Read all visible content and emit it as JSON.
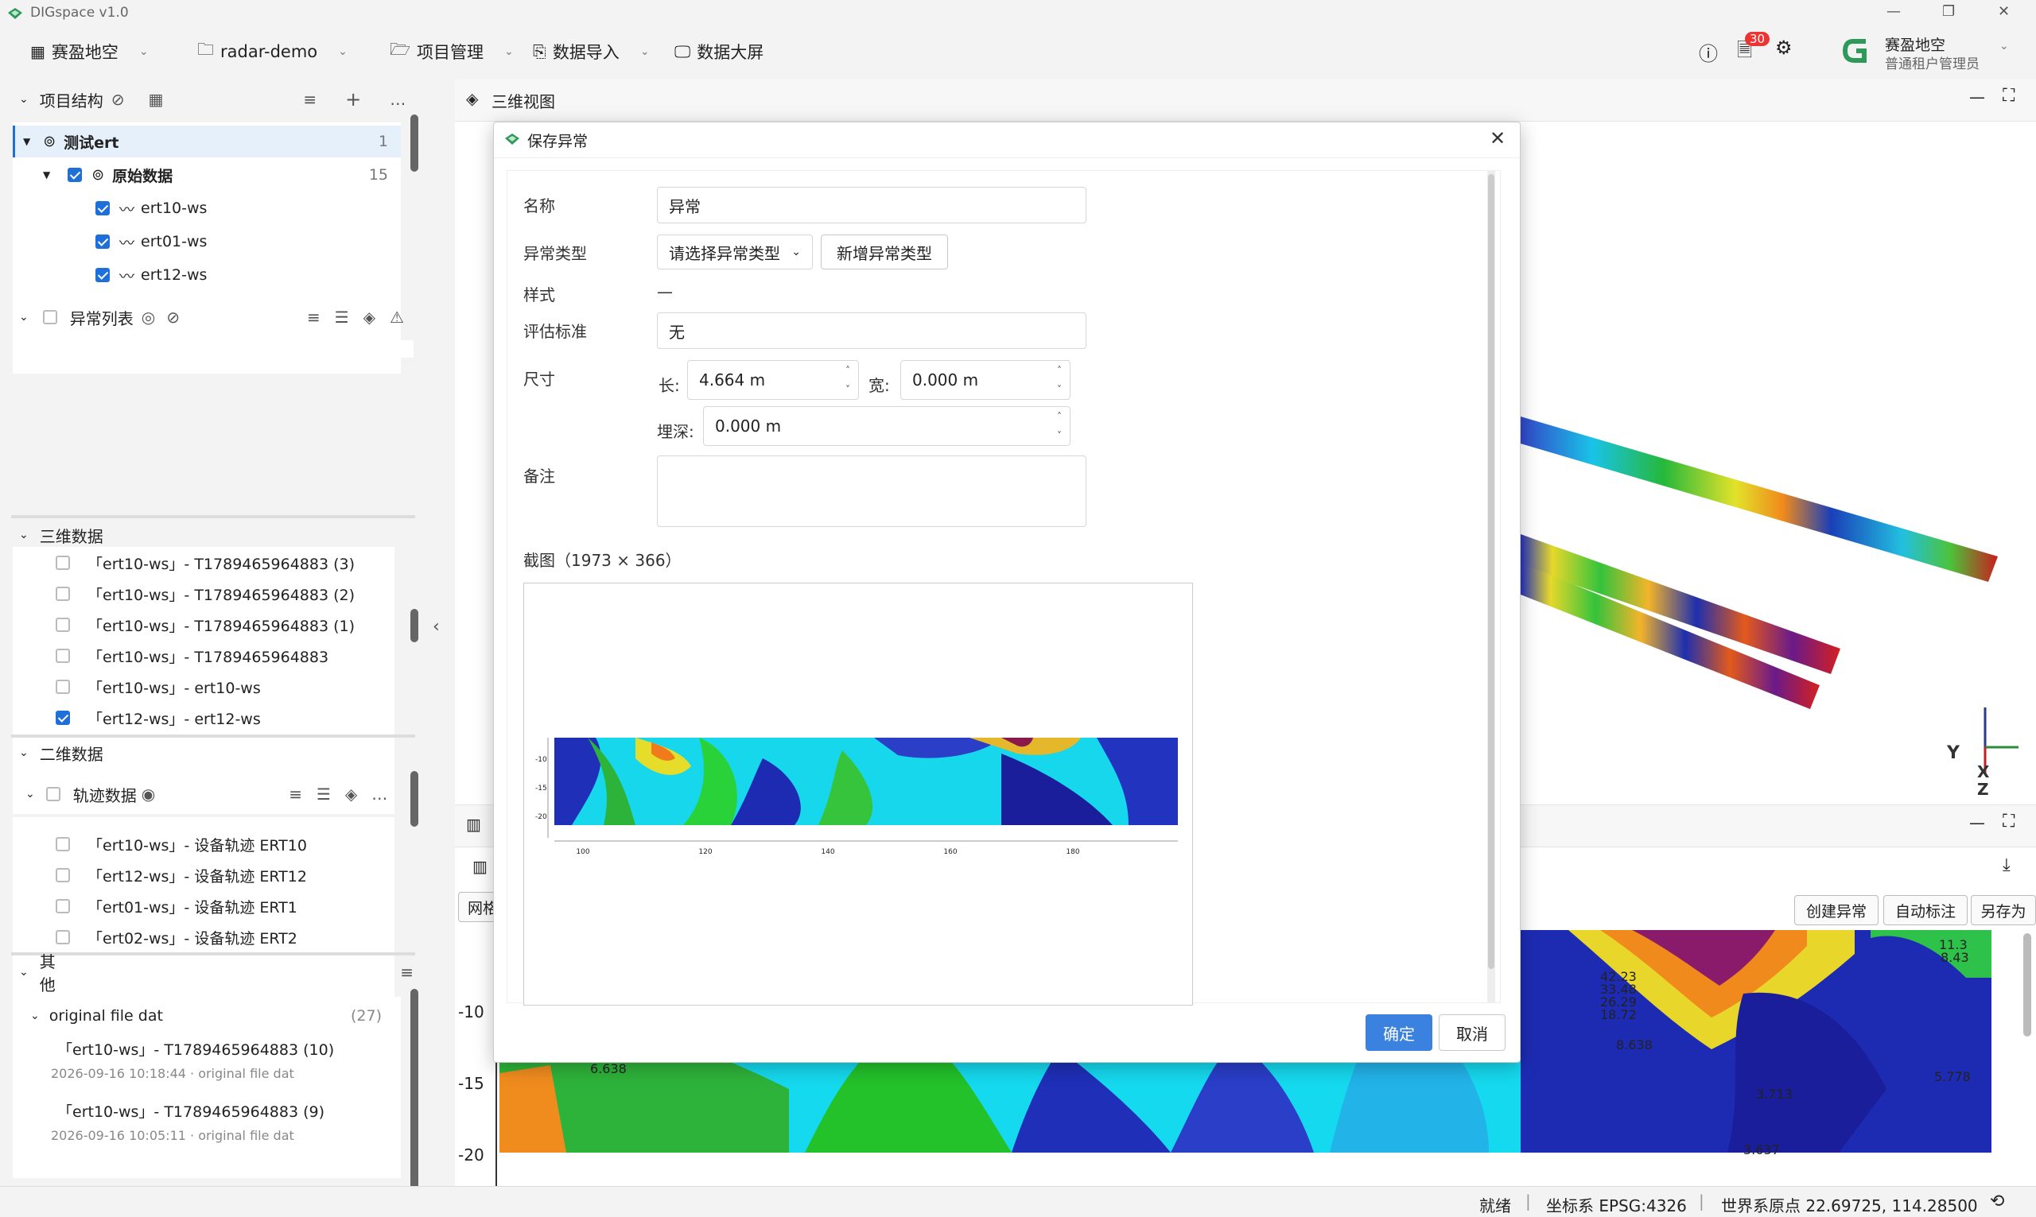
{
  "window": {
    "title": "DIGspace v1.0"
  },
  "menubar": {
    "org": "赛盈地空",
    "project": "radar-demo",
    "items": [
      "项目管理",
      "数据导入",
      "数据大屏"
    ],
    "notif_count": "30",
    "user_name": "赛盈地空",
    "user_role": "普通租户管理员"
  },
  "sidebar": {
    "project_structure": {
      "title": "项目结构",
      "root": {
        "label": "测试ert",
        "count": "1"
      },
      "group": {
        "label": "原始数据",
        "count": "15"
      },
      "items": [
        "ert10-ws",
        "ert01-ws",
        "ert12-ws"
      ]
    },
    "anomaly_list": {
      "title": "异常列表"
    },
    "three_d": {
      "title": "三维数据",
      "items": [
        {
          "label": "「ert10-ws」- T1789465964883 (3)",
          "checked": false
        },
        {
          "label": "「ert10-ws」- T1789465964883 (2)",
          "checked": false
        },
        {
          "label": "「ert10-ws」- T1789465964883 (1)",
          "checked": false
        },
        {
          "label": "「ert10-ws」- T1789465964883",
          "checked": false
        },
        {
          "label": "「ert10-ws」- ert10-ws",
          "checked": false
        },
        {
          "label": "「ert12-ws」- ert12-ws",
          "checked": true
        }
      ]
    },
    "two_d": {
      "title": "二维数据",
      "track_title": "轨迹数据",
      "items": [
        "「ert10-ws」- 设备轨迹 ERT10",
        "「ert12-ws」- 设备轨迹 ERT12",
        "「ert01-ws」- 设备轨迹 ERT1",
        "「ert02-ws」- 设备轨迹 ERT2"
      ]
    },
    "other": {
      "title": "其他",
      "group": "original file dat",
      "group_count": "(27)",
      "files": [
        {
          "name": "「ert10-ws」- T1789465964883 (10)",
          "meta": "2026-09-16 10:18:44 · original file dat"
        },
        {
          "name": "「ert10-ws」- T1789465964883 (9)",
          "meta": "2026-09-16 10:05:11 · original file dat"
        }
      ]
    }
  },
  "main": {
    "view_title": "三维视图",
    "toolbar_buttons": [
      "创建异常",
      "自动标注",
      "另存为"
    ],
    "grid_button": "网格",
    "y_ticks": [
      "-10",
      "-15",
      "-20"
    ],
    "contour_labels": [
      "42.23",
      "33.48",
      "26.29",
      "18.72",
      "8.638",
      "11.3",
      "8.43",
      "3.713",
      "5.778",
      "3.637",
      "6.638"
    ]
  },
  "dialog": {
    "title": "保存异常",
    "name_label": "名称",
    "name_value": "异常",
    "type_label": "异常类型",
    "type_placeholder": "请选择异常类型",
    "add_type_button": "新增异常类型",
    "style_label": "样式",
    "style_value": "—",
    "standard_label": "评估标准",
    "standard_value": "无",
    "size_label": "尺寸",
    "length_label": "长:",
    "length_value": "4.664 m",
    "width_label": "宽:",
    "width_value": "0.000 m",
    "depth_label": "埋深:",
    "depth_value": "0.000 m",
    "note_label": "备注",
    "screenshot_label": "截图（1973 × 366）",
    "thumb_x_ticks": [
      "100",
      "120",
      "140",
      "160",
      "180"
    ],
    "thumb_y_ticks": [
      "-10",
      "-15",
      "-20"
    ],
    "ok_button": "确定",
    "cancel_button": "取消"
  },
  "status": {
    "state": "就绪",
    "crs": "坐标系 EPSG:4326",
    "origin": "世界系原点  22.69725, 114.28500"
  }
}
